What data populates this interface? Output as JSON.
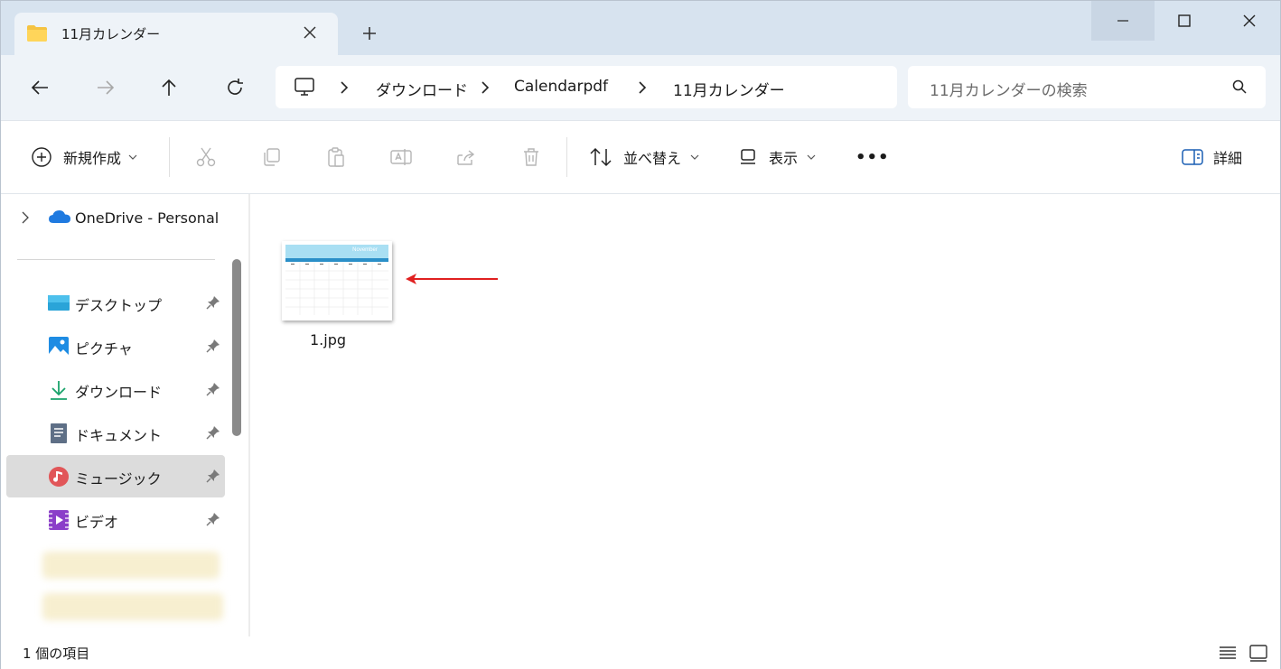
{
  "window": {
    "tab_title": "11月カレンダー",
    "new_tab_label": "+"
  },
  "address": {
    "crumbs": [
      "ダウンロード",
      "Calendarpdf",
      "11月カレンダー"
    ],
    "search_placeholder": "11月カレンダーの検索"
  },
  "toolbar": {
    "new_label": "新規作成",
    "sort_label": "並べ替え",
    "view_label": "表示",
    "more_label": "•••",
    "details_label": "詳細"
  },
  "sidebar": {
    "onedrive_label": "OneDrive - Personal",
    "items": [
      {
        "label": "デスクトップ",
        "icon": "desktop-icon"
      },
      {
        "label": "ピクチャ",
        "icon": "pictures-icon"
      },
      {
        "label": "ダウンロード",
        "icon": "downloads-icon"
      },
      {
        "label": "ドキュメント",
        "icon": "documents-icon"
      },
      {
        "label": "ミュージック",
        "icon": "music-icon"
      },
      {
        "label": "ビデオ",
        "icon": "videos-icon"
      }
    ]
  },
  "content": {
    "files": [
      {
        "name": "1.jpg",
        "thumb_title": "November",
        "type": "image"
      }
    ]
  },
  "status": {
    "item_count": "1 個の項目"
  },
  "colors": {
    "titlebar": "#d7e3ef",
    "navbar": "#eef3f8",
    "selected": "#dcdcdc",
    "arrow": "#e02020",
    "calendar_header": "#a9dff3",
    "calendar_band": "#2a8fc8"
  }
}
